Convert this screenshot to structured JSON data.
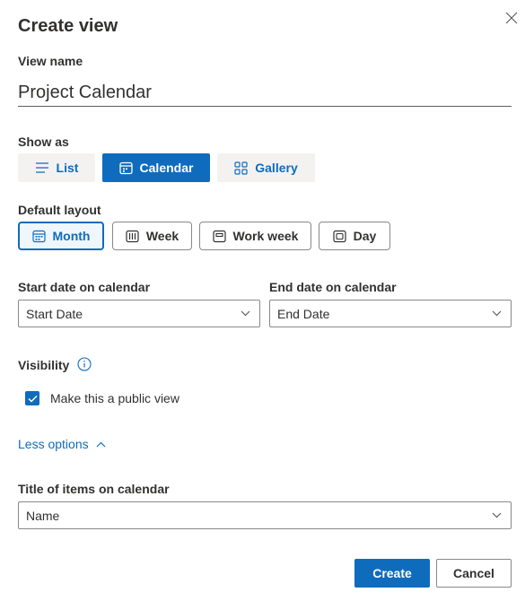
{
  "dialog": {
    "title": "Create view"
  },
  "view_name": {
    "label": "View name",
    "value": "Project Calendar"
  },
  "show_as": {
    "label": "Show as",
    "options": [
      {
        "label": "List",
        "icon": "list-icon",
        "selected": false
      },
      {
        "label": "Calendar",
        "icon": "calendar-icon",
        "selected": true
      },
      {
        "label": "Gallery",
        "icon": "grid-icon",
        "selected": false
      }
    ]
  },
  "default_layout": {
    "label": "Default layout",
    "options": [
      {
        "label": "Month",
        "icon": "calendar-month-icon",
        "selected": true
      },
      {
        "label": "Week",
        "icon": "calendar-week-icon",
        "selected": false
      },
      {
        "label": "Work week",
        "icon": "calendar-work-week-icon",
        "selected": false
      },
      {
        "label": "Day",
        "icon": "calendar-day-icon",
        "selected": false
      }
    ]
  },
  "start_date": {
    "label": "Start date on calendar",
    "value": "Start Date"
  },
  "end_date": {
    "label": "End date on calendar",
    "value": "End Date"
  },
  "visibility": {
    "label": "Visibility",
    "checkbox_label": "Make this a public view",
    "checked": true
  },
  "options_toggle": {
    "label": "Less options"
  },
  "item_title": {
    "label": "Title of items on calendar",
    "value": "Name"
  },
  "actions": {
    "create_label": "Create",
    "cancel_label": "Cancel"
  },
  "colors": {
    "accent": "#0f6cbd",
    "text": "#323130",
    "border": "#8a8886"
  }
}
